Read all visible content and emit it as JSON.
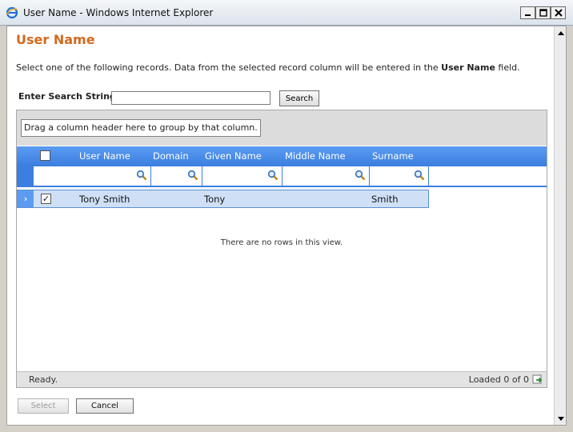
{
  "window": {
    "title": "User Name - Windows Internet Explorer",
    "min_icon": "minimize-icon",
    "max_icon": "maximize-icon",
    "close_icon": "close-icon"
  },
  "page": {
    "title": "User Name",
    "instructions_pre": "Select one of the following records. Data from the selected record column will be entered in the ",
    "instructions_field": "User Name",
    "instructions_post": " field."
  },
  "search": {
    "label": "Enter Search String:",
    "value": "",
    "button_label": "Search"
  },
  "grid": {
    "group_hint": "Drag a column header here to group by that column.",
    "columns": [
      "User Name",
      "Domain",
      "Given Name",
      "Middle Name",
      "Surname"
    ],
    "rows": [
      {
        "checked": true,
        "user_name": "Tony Smith",
        "domain": "",
        "given_name": "Tony",
        "middle_name": "",
        "surname": "Smith"
      }
    ],
    "no_rows_text": "There are no rows in this view.",
    "status": "Ready.",
    "loaded": "Loaded 0 of 0"
  },
  "buttons": {
    "select": "Select",
    "cancel": "Cancel"
  },
  "colors": {
    "title_orange": "#d2691e",
    "header_blue": "#3b7fe0",
    "selected_row": "#cfe0f6"
  }
}
